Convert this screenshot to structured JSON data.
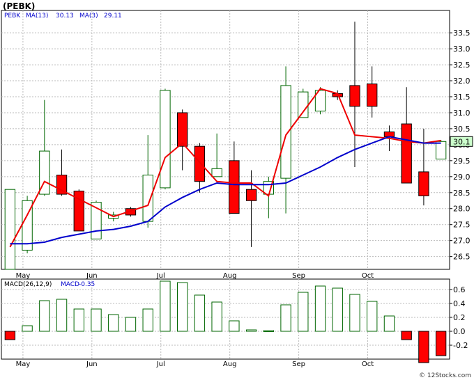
{
  "chart_data": [
    {
      "type": "candlestick",
      "title": "(PEBK)",
      "legend": {
        "symbol": "PEBK",
        "ma13_label": "MA(13)",
        "ma13_value": "30.13",
        "ma3_label": "MA(3)",
        "ma3_value": "29.11"
      },
      "months": [
        "May",
        "Jun",
        "Jul",
        "Aug",
        "Sep",
        "Oct"
      ],
      "month_positions": [
        1.25,
        5.25,
        9.25,
        13.25,
        17.25,
        21.25
      ],
      "yticks": [
        "26.5",
        "27.0",
        "27.5",
        "28.0",
        "28.5",
        "29.0",
        "29.5",
        "30.0",
        "30.5",
        "31.0",
        "31.5",
        "32.0",
        "32.5",
        "33.0",
        "33.5"
      ],
      "ylim": [
        26.1,
        34.2
      ],
      "last_price_label": "30.1",
      "candles": [
        {
          "open": 26.1,
          "close": 28.6,
          "high": 28.6,
          "low": 26.1,
          "dir": "up"
        },
        {
          "open": 26.7,
          "close": 28.25,
          "high": 28.4,
          "low": 26.6,
          "dir": "up"
        },
        {
          "open": 28.45,
          "close": 29.8,
          "high": 31.4,
          "low": 28.4,
          "dir": "up"
        },
        {
          "open": 29.05,
          "close": 28.45,
          "high": 29.85,
          "low": 28.4,
          "dir": "down"
        },
        {
          "open": 28.55,
          "close": 27.3,
          "high": 28.6,
          "low": 27.3,
          "dir": "down"
        },
        {
          "open": 27.05,
          "close": 28.2,
          "high": 28.25,
          "low": 27.05,
          "dir": "up"
        },
        {
          "open": 27.7,
          "close": 27.8,
          "high": 27.9,
          "low": 27.6,
          "dir": "up"
        },
        {
          "open": 28.0,
          "close": 27.8,
          "high": 28.05,
          "low": 27.75,
          "dir": "down"
        },
        {
          "open": 27.6,
          "close": 29.05,
          "high": 30.3,
          "low": 27.4,
          "dir": "up"
        },
        {
          "open": 28.65,
          "close": 31.7,
          "high": 31.75,
          "low": 28.6,
          "dir": "up"
        },
        {
          "open": 31.0,
          "close": 29.95,
          "high": 31.1,
          "low": 29.2,
          "dir": "down"
        },
        {
          "open": 29.95,
          "close": 28.85,
          "high": 30.05,
          "low": 28.5,
          "dir": "down"
        },
        {
          "open": 29.0,
          "close": 29.25,
          "high": 30.35,
          "low": 29.0,
          "dir": "up"
        },
        {
          "open": 29.5,
          "close": 27.85,
          "high": 30.1,
          "low": 27.85,
          "dir": "down"
        },
        {
          "open": 28.6,
          "close": 28.25,
          "high": 29.2,
          "low": 26.8,
          "dir": "down"
        },
        {
          "open": 28.45,
          "close": 28.85,
          "high": 29.0,
          "low": 27.7,
          "dir": "up"
        },
        {
          "open": 28.95,
          "close": 31.85,
          "high": 32.45,
          "low": 27.85,
          "dir": "up"
        },
        {
          "open": 30.85,
          "close": 31.65,
          "high": 31.75,
          "low": 30.85,
          "dir": "up"
        },
        {
          "open": 31.05,
          "close": 31.7,
          "high": 31.8,
          "low": 30.95,
          "dir": "up"
        },
        {
          "open": 31.6,
          "close": 31.5,
          "high": 31.7,
          "low": 31.4,
          "dir": "down"
        },
        {
          "open": 31.85,
          "close": 31.2,
          "high": 33.85,
          "low": 29.3,
          "dir": "down"
        },
        {
          "open": 31.9,
          "close": 31.2,
          "high": 32.45,
          "low": 30.85,
          "dir": "down"
        },
        {
          "open": 30.4,
          "close": 30.25,
          "high": 30.6,
          "low": 29.8,
          "dir": "down"
        },
        {
          "open": 30.65,
          "close": 28.8,
          "high": 31.8,
          "low": 28.8,
          "dir": "down"
        },
        {
          "open": 29.15,
          "close": 28.4,
          "high": 30.5,
          "low": 28.1,
          "dir": "down"
        },
        {
          "open": 29.55,
          "close": 30.1,
          "high": 30.15,
          "low": 29.55,
          "dir": "up"
        }
      ],
      "ma13": [
        26.8,
        27.8,
        28.85,
        null,
        null,
        null,
        27.75,
        null,
        28.1,
        29.6,
        30.05,
        null,
        28.85,
        28.8,
        28.8,
        28.4,
        30.3,
        null,
        31.75,
        31.6,
        30.3,
        null,
        30.2,
        30.1,
        30.05,
        30.13
      ],
      "ma3": [
        26.9,
        26.9,
        26.95,
        27.1,
        27.2,
        27.3,
        27.35,
        27.45,
        27.6,
        28.05,
        28.35,
        28.6,
        28.8,
        28.75,
        28.75,
        28.75,
        28.8,
        29.05,
        29.3,
        29.6,
        29.85,
        30.05,
        30.25,
        30.15,
        30.05,
        30.05
      ]
    },
    {
      "type": "bar",
      "title": "MACD(26,12,9)",
      "legend": {
        "macd_label": "MACD(26,12,9)",
        "value_label": "MACD",
        "value": "-0.35"
      },
      "yticks": [
        "-0.2",
        "0.0",
        "0.2",
        "0.4",
        "0.6"
      ],
      "ylim": [
        -0.4,
        0.75
      ],
      "values": [
        -0.12,
        0.08,
        0.44,
        0.46,
        0.32,
        0.32,
        0.24,
        0.2,
        0.32,
        0.72,
        0.7,
        0.52,
        0.42,
        0.15,
        0.02,
        0.01,
        0.38,
        0.56,
        0.65,
        0.62,
        0.53,
        0.43,
        0.22,
        -0.12,
        -0.45,
        -0.35
      ]
    }
  ],
  "footer": {
    "credit": "© 12Stocks.com"
  }
}
